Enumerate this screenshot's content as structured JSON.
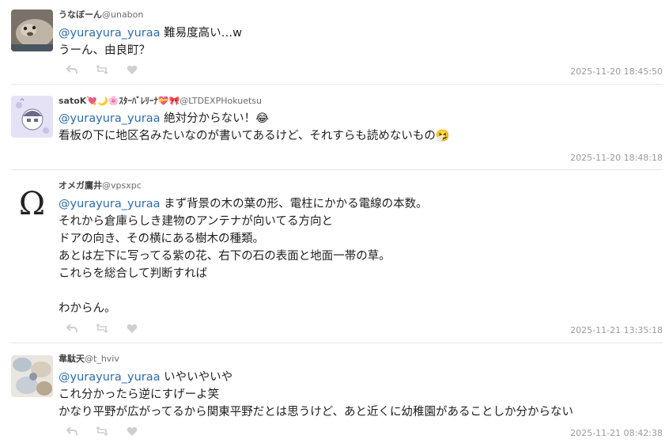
{
  "posts": [
    {
      "name": "うなぼーん",
      "acct": "@unabon",
      "mention": "@yurayura_yuraa",
      "lines": [
        "難易度高い…w",
        "うーん、由良町？"
      ],
      "time": "2025-11-20 18:45:50"
    },
    {
      "name": "satoK💘🌙🌸ｽﾀｰﾊﾞﾚﾘｰﾅ💝🎀",
      "acct": "@LTDEXPHokuetsu",
      "mention": "@yurayura_yuraa",
      "lines": [
        "絶対分からない！😂",
        "看板の下に地区名みたいなのが書いてあるけど、それすらも読めないもの🤧"
      ],
      "time": "2025-11-20 18:48:18"
    },
    {
      "name": "オメガ鷹井",
      "acct": "@vpsxpc",
      "avatar_glyph": "Ω",
      "mention": "@yurayura_yuraa",
      "lines": [
        "まず背景の木の葉の形、電柱にかかる電線の本数。",
        "それから倉庫らしき建物のアンテナが向いてる方向と",
        "ドアの向き、その横にある樹木の種類。",
        "あとは左下に写ってる紫の花、右下の石の表面と地面一帯の草。",
        "これらを総合して判断すれば",
        "",
        "わからん。"
      ],
      "time": "2025-11-21 13:35:18"
    },
    {
      "name": "韋駄天",
      "acct": "@t_hviv",
      "mention": "@yurayura_yuraa",
      "lines": [
        "いやいやいや",
        "これ分かったら逆にすげーよ笑",
        "かなり平野が広がってるから関東平野だとは思うけど、あと近くに幼稚園があることしか分からない"
      ],
      "time": "2025-11-21 08:42:38"
    }
  ],
  "icons": [
    "reply-icon",
    "boost-icon",
    "favourite-icon"
  ]
}
